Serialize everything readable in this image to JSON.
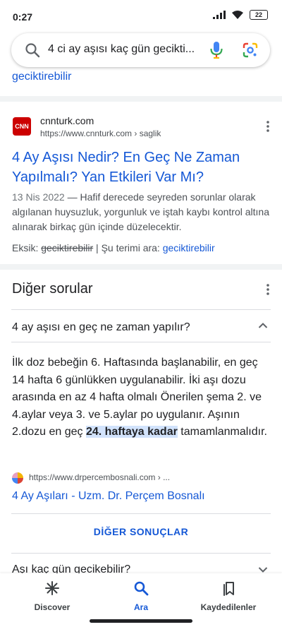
{
  "status_bar": {
    "time": "0:27",
    "battery": "22"
  },
  "search": {
    "query": "4 ci ay aşısı kaç gün gecikti..."
  },
  "partial_result": {
    "link_text": "geciktirebilir"
  },
  "result": {
    "site_name": "cnnturk.com",
    "url": "https://www.cnnturk.com",
    "url_path": " › saglik",
    "title": "4 Ay Aşısı Nedir? En Geç Ne Zaman Yapılmalı? Yan Etkileri Var Mı?",
    "date": "13 Nis 2022",
    "snippet": " — Hafif derecede seyreden sorunlar olarak algılanan huysuzluk, yorgunluk ve iştah kaybı kontrol altına alınarak birkaç gün içinde düzelecektir.",
    "missing_label": "Eksik: ",
    "missing_term": "geciktirebilir",
    "must_include_label": " | Şu terimi ara: ",
    "must_include_term": "geciktirebilir"
  },
  "paa": {
    "header": "Diğer sorular",
    "question_1": "4 ay aşısı en geç ne zaman yapılır?",
    "answer_text": "İlk doz bebeğin 6. Haftasında başlanabilir, en geç 14 hafta 6 günlükken uygulanabilir. İki aşı dozu arasında en az 4 hafta olmalı Önerilen şema 2. ve 4.aylar veya 3. ve 5.aylar po uygulanır. Aşının 2.dozu en geç ",
    "answer_highlight": "24. haftaya kadar",
    "answer_tail": " tamamlanmalıdır.",
    "source_url": "https://www.drpercembosnali.com › ...",
    "source_title": "4 Ay Aşıları - Uzm. Dr. Perçem Bosnalı",
    "more_results": "DİĞER SONUÇLAR",
    "question_2": "Aşı kaç gün gecikebilir?"
  },
  "bottom_nav": {
    "discover": "Discover",
    "search": "Ara",
    "saved": "Kaydedilenler"
  },
  "colors": {
    "link": "#1558d6",
    "accent": "#1a73e8",
    "text": "#202124"
  }
}
